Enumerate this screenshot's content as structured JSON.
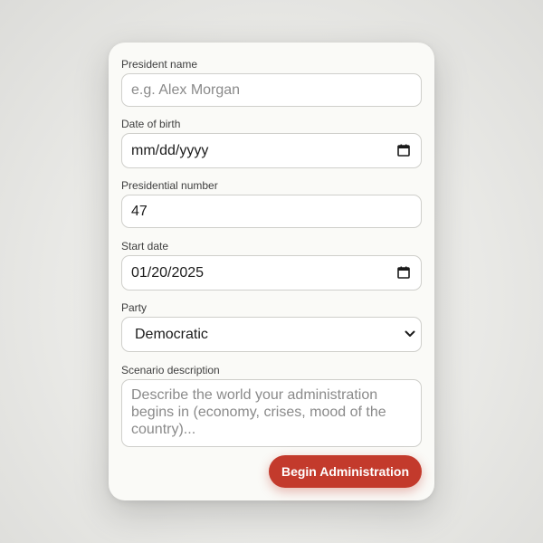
{
  "form": {
    "president_name": {
      "label": "President name",
      "placeholder": "e.g. Alex Morgan",
      "value": ""
    },
    "date_of_birth": {
      "label": "Date of birth",
      "value": "mm/dd/yyyy",
      "icon": "calendar-icon"
    },
    "presidential_number": {
      "label": "Presidential number",
      "value": "47"
    },
    "start_date": {
      "label": "Start date",
      "value": "01/20/2025",
      "icon": "calendar-icon"
    },
    "party": {
      "label": "Party",
      "selected": "Democratic",
      "icon": "chevron-down-icon"
    },
    "scenario": {
      "label": "Scenario description",
      "placeholder": "Describe the world your administration begins in (economy, crises, mood of the country)..."
    },
    "submit_label": "Begin Administration"
  },
  "colors": {
    "accent": "#c33a2c",
    "card_bg": "#fafaf7",
    "border": "#cfcfcb"
  }
}
